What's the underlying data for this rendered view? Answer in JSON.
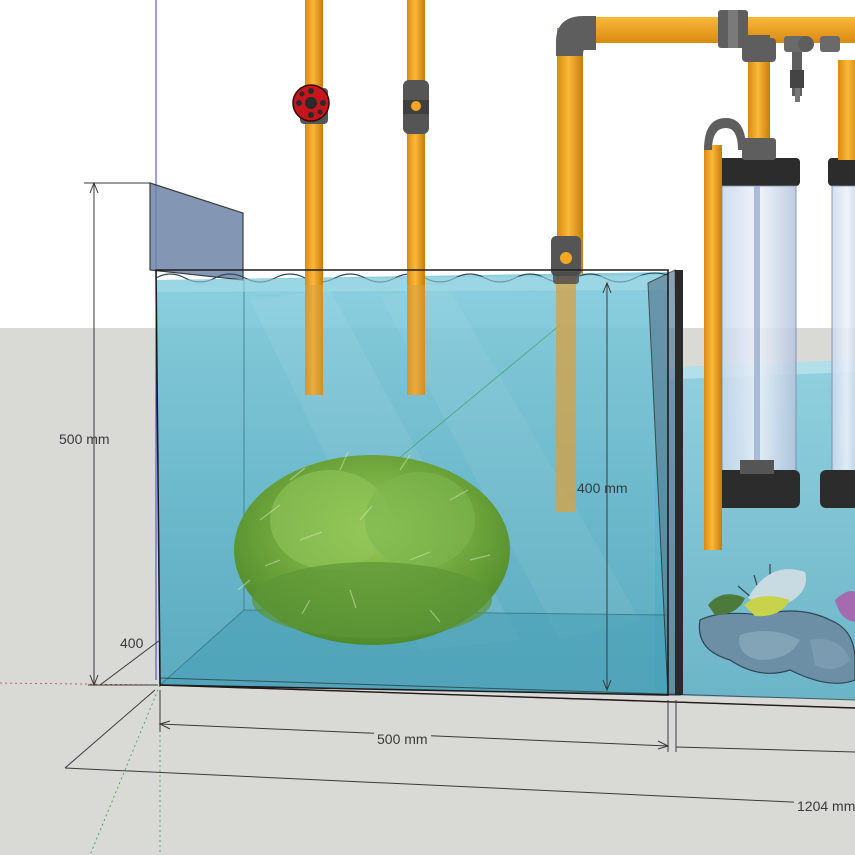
{
  "viewport": {
    "sky_color": "#ffffff",
    "ground_color": "#d9d9d5"
  },
  "colors": {
    "water": "#5fb6cc",
    "water_deep": "#3f97ae",
    "pipe": "#f5a623",
    "fitting": "#5e5e5e",
    "glass_panel": "#6e86a8",
    "axis_blue": "#3a3ae0",
    "axis_red": "#d63a3a",
    "axis_green": "#2f9e4f",
    "dimension_line": "#3a3a3a"
  },
  "dimensions": {
    "tank_height": "500 mm",
    "tank_depth": "400",
    "water_height": "400 mm",
    "display_width": "500 mm",
    "total_length": "1204 mm"
  },
  "icons": {
    "red_valve": "gate-valve-icon",
    "ball_valve": "ball-valve-icon",
    "coral": "coral-icon",
    "plant": "plant-icon"
  }
}
